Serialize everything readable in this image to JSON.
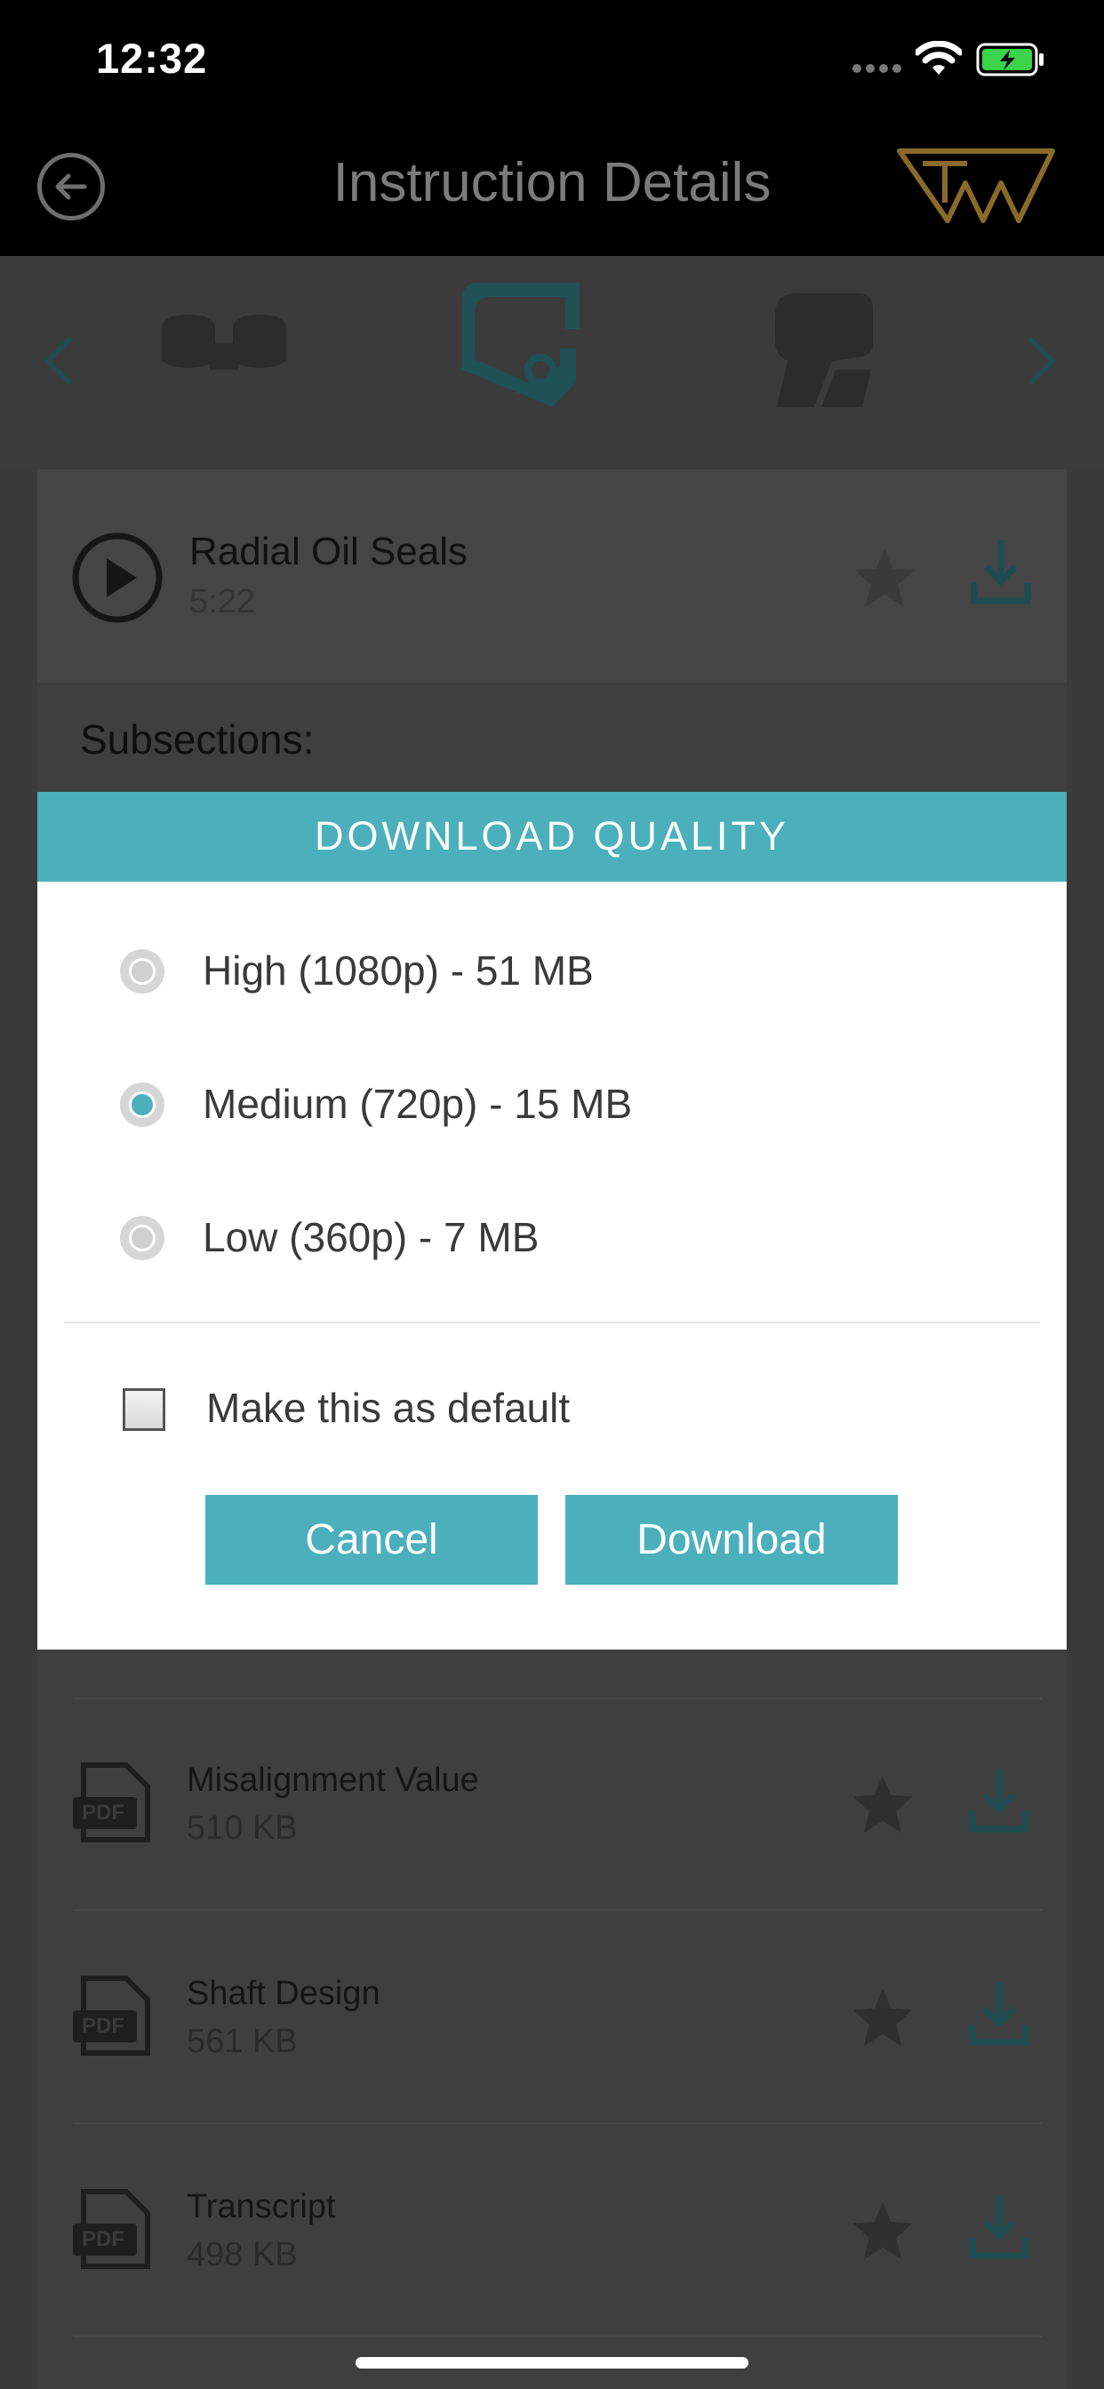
{
  "status_bar": {
    "time": "12:32"
  },
  "header": {
    "title": "Instruction Details"
  },
  "video": {
    "title": "Radial Oil Seals",
    "duration": "5:22"
  },
  "subsections_label": "Subsections:",
  "files": [
    {
      "name": "Misalignment Value",
      "size": "510 KB",
      "type_label": "PDF"
    },
    {
      "name": "Shaft Design",
      "size": "561 KB",
      "type_label": "PDF"
    },
    {
      "name": "Transcript",
      "size": "498 KB",
      "type_label": "PDF"
    }
  ],
  "modal": {
    "title": "DOWNLOAD QUALITY",
    "options": [
      {
        "label": "High (1080p) - 51 MB",
        "selected": false
      },
      {
        "label": "Medium (720p) - 15 MB",
        "selected": true
      },
      {
        "label": "Low (360p) - 7 MB",
        "selected": false
      }
    ],
    "default_checkbox_label": "Make this as default",
    "default_checked": false,
    "cancel_label": "Cancel",
    "download_label": "Download"
  },
  "colors": {
    "accent": "#4bb0bb",
    "brand_gold": "#8a6a2a",
    "dim_teal": "#1f5156"
  }
}
